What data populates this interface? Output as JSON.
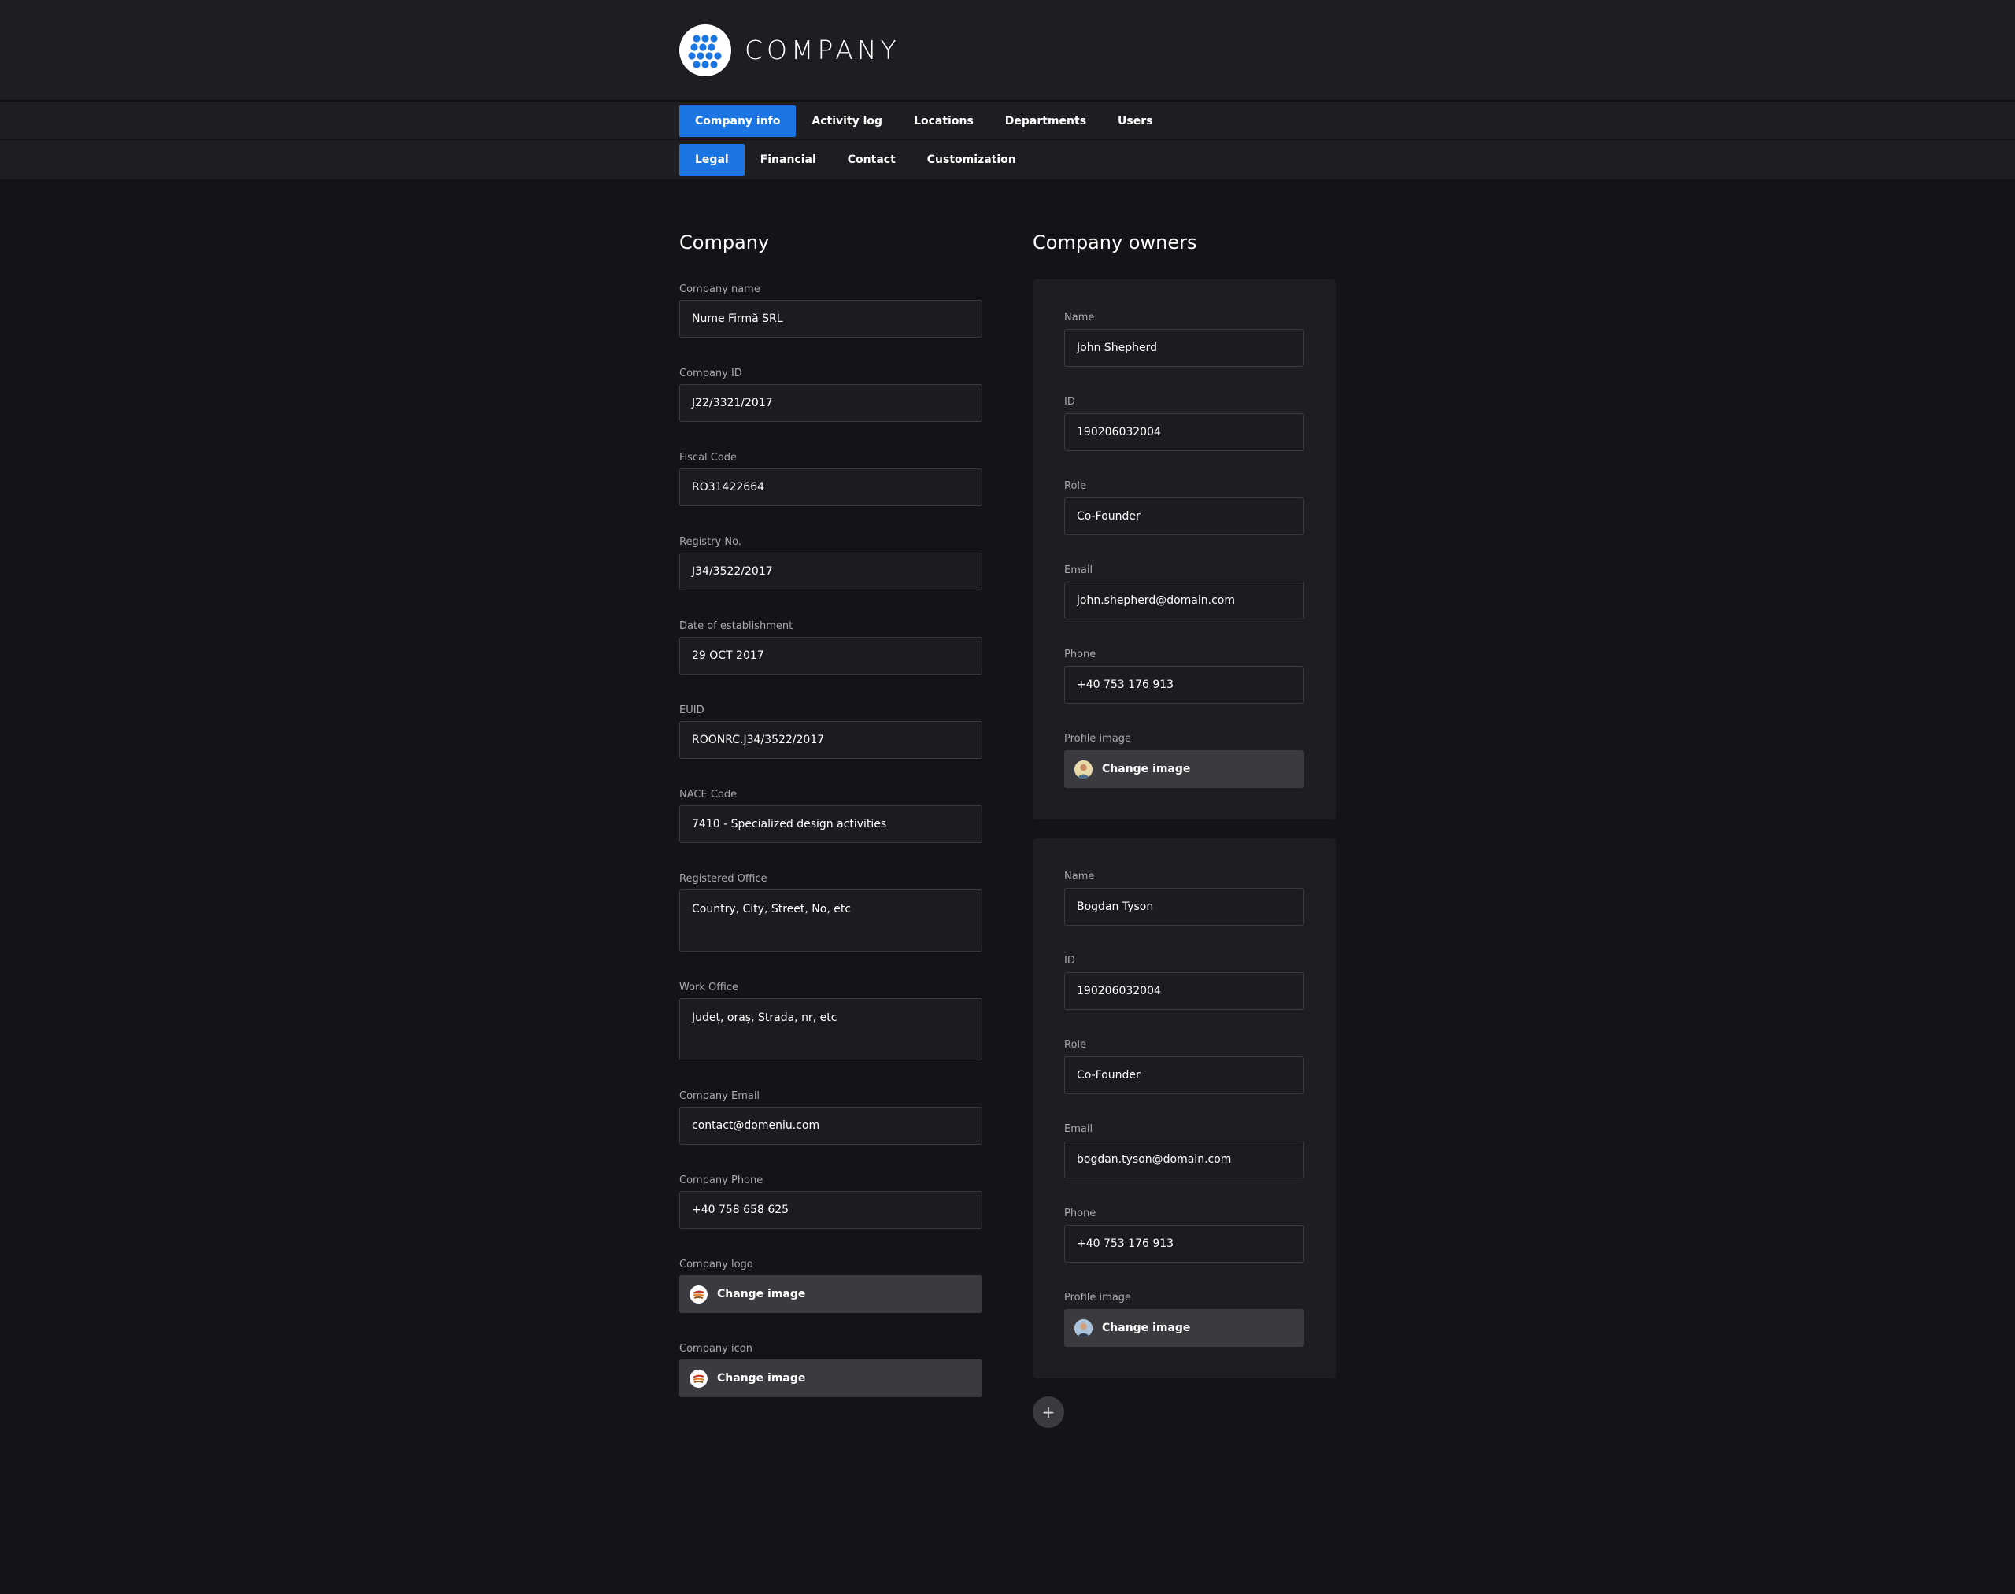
{
  "header": {
    "brand": "COMPANY",
    "logo_icon": "dots-grid-logo-icon",
    "accent": "#1b76e4"
  },
  "nav": {
    "main_tabs": [
      {
        "label": "Company info",
        "active": true
      },
      {
        "label": "Activity log",
        "active": false
      },
      {
        "label": "Locations",
        "active": false
      },
      {
        "label": "Departments",
        "active": false
      },
      {
        "label": "Users",
        "active": false
      }
    ],
    "sub_tabs": [
      {
        "label": "Legal",
        "active": true
      },
      {
        "label": "Financial",
        "active": false
      },
      {
        "label": "Contact",
        "active": false
      },
      {
        "label": "Customization",
        "active": false
      }
    ]
  },
  "company": {
    "title": "Company",
    "fields": [
      {
        "label": "Company name",
        "value": "Nume Firmă SRL"
      },
      {
        "label": "Company ID",
        "value": "J22/3321/2017"
      },
      {
        "label": "Fiscal Code",
        "value": "RO31422664"
      },
      {
        "label": "Registry No.",
        "value": "J34/3522/2017"
      },
      {
        "label": "Date of establishment",
        "value": "29 OCT 2017"
      },
      {
        "label": "EUID",
        "value": "ROONRC.J34/3522/2017"
      },
      {
        "label": "NACE Code",
        "value": "7410 - Specialized design activities"
      },
      {
        "label": "Registered Office",
        "value": "Country, City, Street, No, etc"
      },
      {
        "label": "Work Office",
        "value": "Județ, oraș, Strada, nr, etc"
      },
      {
        "label": "Company Email",
        "value": "contact@domeniu.com"
      },
      {
        "label": "Company Phone",
        "value": "+40 758 658 625"
      }
    ],
    "logo": {
      "label": "Company logo",
      "button": "Change image"
    },
    "icon": {
      "label": "Company icon",
      "button": "Change image"
    }
  },
  "owners": {
    "title": "Company owners",
    "labels": {
      "name": "Name",
      "id": "ID",
      "role": "Role",
      "email": "Email",
      "phone": "Phone",
      "image": "Profile image"
    },
    "items": [
      {
        "name": "John Shepherd",
        "id": "190206032004",
        "role": "Co-Founder",
        "email": "john.shepherd@domain.com",
        "phone": "+40 753 176 913",
        "image_button": "Change image"
      },
      {
        "name": "Bogdan Tyson",
        "id": "190206032004",
        "role": "Co-Founder",
        "email": "bogdan.tyson@domain.com",
        "phone": "+40 753 176 913",
        "image_button": "Change image"
      }
    ],
    "add_button": "+"
  }
}
